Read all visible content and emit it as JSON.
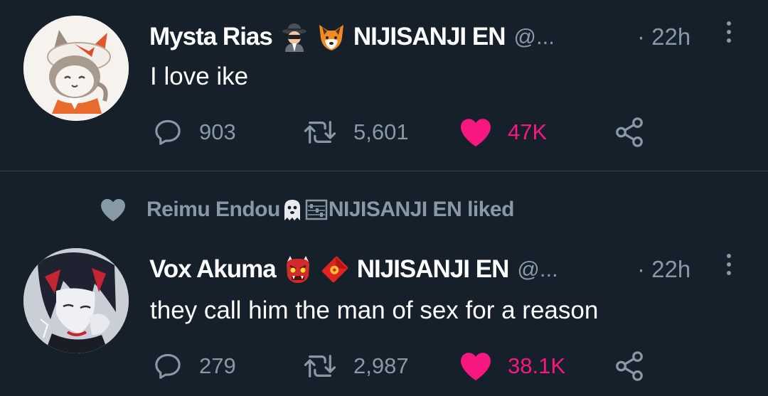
{
  "tweets": [
    {
      "display_name": "Mysta Rias",
      "emojis": [
        "detective-emoji",
        "fox-emoji"
      ],
      "org_name": "NIJISANJI EN",
      "handle": "@...",
      "time": "· 22h",
      "text": "I love ike",
      "replies": "903",
      "retweets": "5,601",
      "likes": "47K",
      "liked": true
    },
    {
      "display_name": "Vox Akuma",
      "emojis": [
        "ogre-emoji",
        "red-envelope-emoji"
      ],
      "org_name": "NIJISANJI EN",
      "handle": "@...",
      "time": "· 22h",
      "text": "they call him the man of sex for a reason",
      "replies": "279",
      "retweets": "2,987",
      "likes": "38.1K",
      "liked": true
    }
  ],
  "social_context": {
    "name": "Reimu Endou",
    "suffix": "NIJISANJI EN liked",
    "emojis": [
      "ghost-emoji",
      "abacus-emoji"
    ]
  },
  "colors": {
    "background": "#15202b",
    "muted": "#8899a6",
    "like": "#f91880",
    "divider": "#38444d"
  }
}
